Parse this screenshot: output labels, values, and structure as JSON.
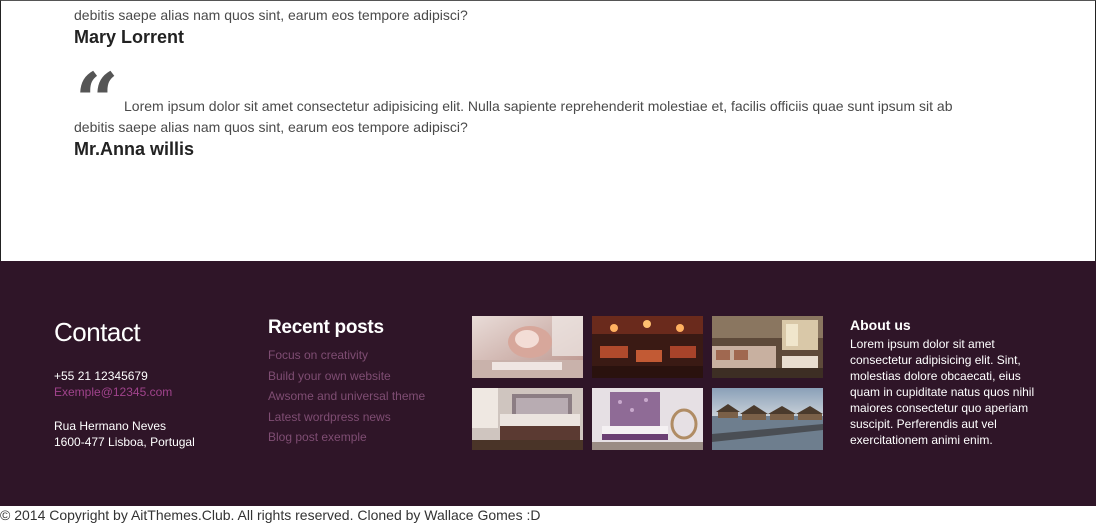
{
  "testimonials": [
    {
      "text_line2": "debitis saepe alias nam quos sint, earum eos tempore adipisci?",
      "author": "Mary Lorrent"
    },
    {
      "quote_glyph": "“",
      "text_line1": "Lorem ipsum dolor sit amet consectetur adipisicing elit. Nulla sapiente reprehenderit molestiae et, facilis officiis quae sunt ipsum sit ab",
      "text_line2": "debitis saepe alias nam quos sint, earum eos tempore adipisci?",
      "author": "Mr.Anna willis"
    }
  ],
  "footer": {
    "contact": {
      "title": "Contact",
      "phone": "+55 21 12345679",
      "email": "Exemple@12345.com",
      "street": "Rua Hermano Neves",
      "city": "1600-477 Lisboa, Portugal"
    },
    "recent_posts": {
      "title": "Recent posts",
      "items": [
        "Focus on creativity",
        "Build your own website",
        "Awsome and universal theme",
        "Latest wordpress news",
        "Blog post exemple"
      ]
    },
    "gallery": {
      "images": [
        "spa-photo",
        "restaurant-photo",
        "hotel-suite-photo",
        "bedroom-photo",
        "purple-room-photo",
        "water-villas-photo"
      ]
    },
    "about": {
      "title": "About us",
      "text": "Lorem ipsum dolor sit amet consectetur adipisicing elit. Sint, molestias dolore obcaecati, eius quam in cupiditate natus quos nihil maiores consectetur quo aperiam suscipit. Perferendis aut vel exercitationem animi enim."
    },
    "colors": {
      "background": "#2f1528",
      "link": "#7f4d73",
      "email": "#a0438c"
    }
  },
  "copyright": "© 2014 Copyright by AitThemes.Club. All rights reserved. Cloned by Wallace Gomes :D"
}
